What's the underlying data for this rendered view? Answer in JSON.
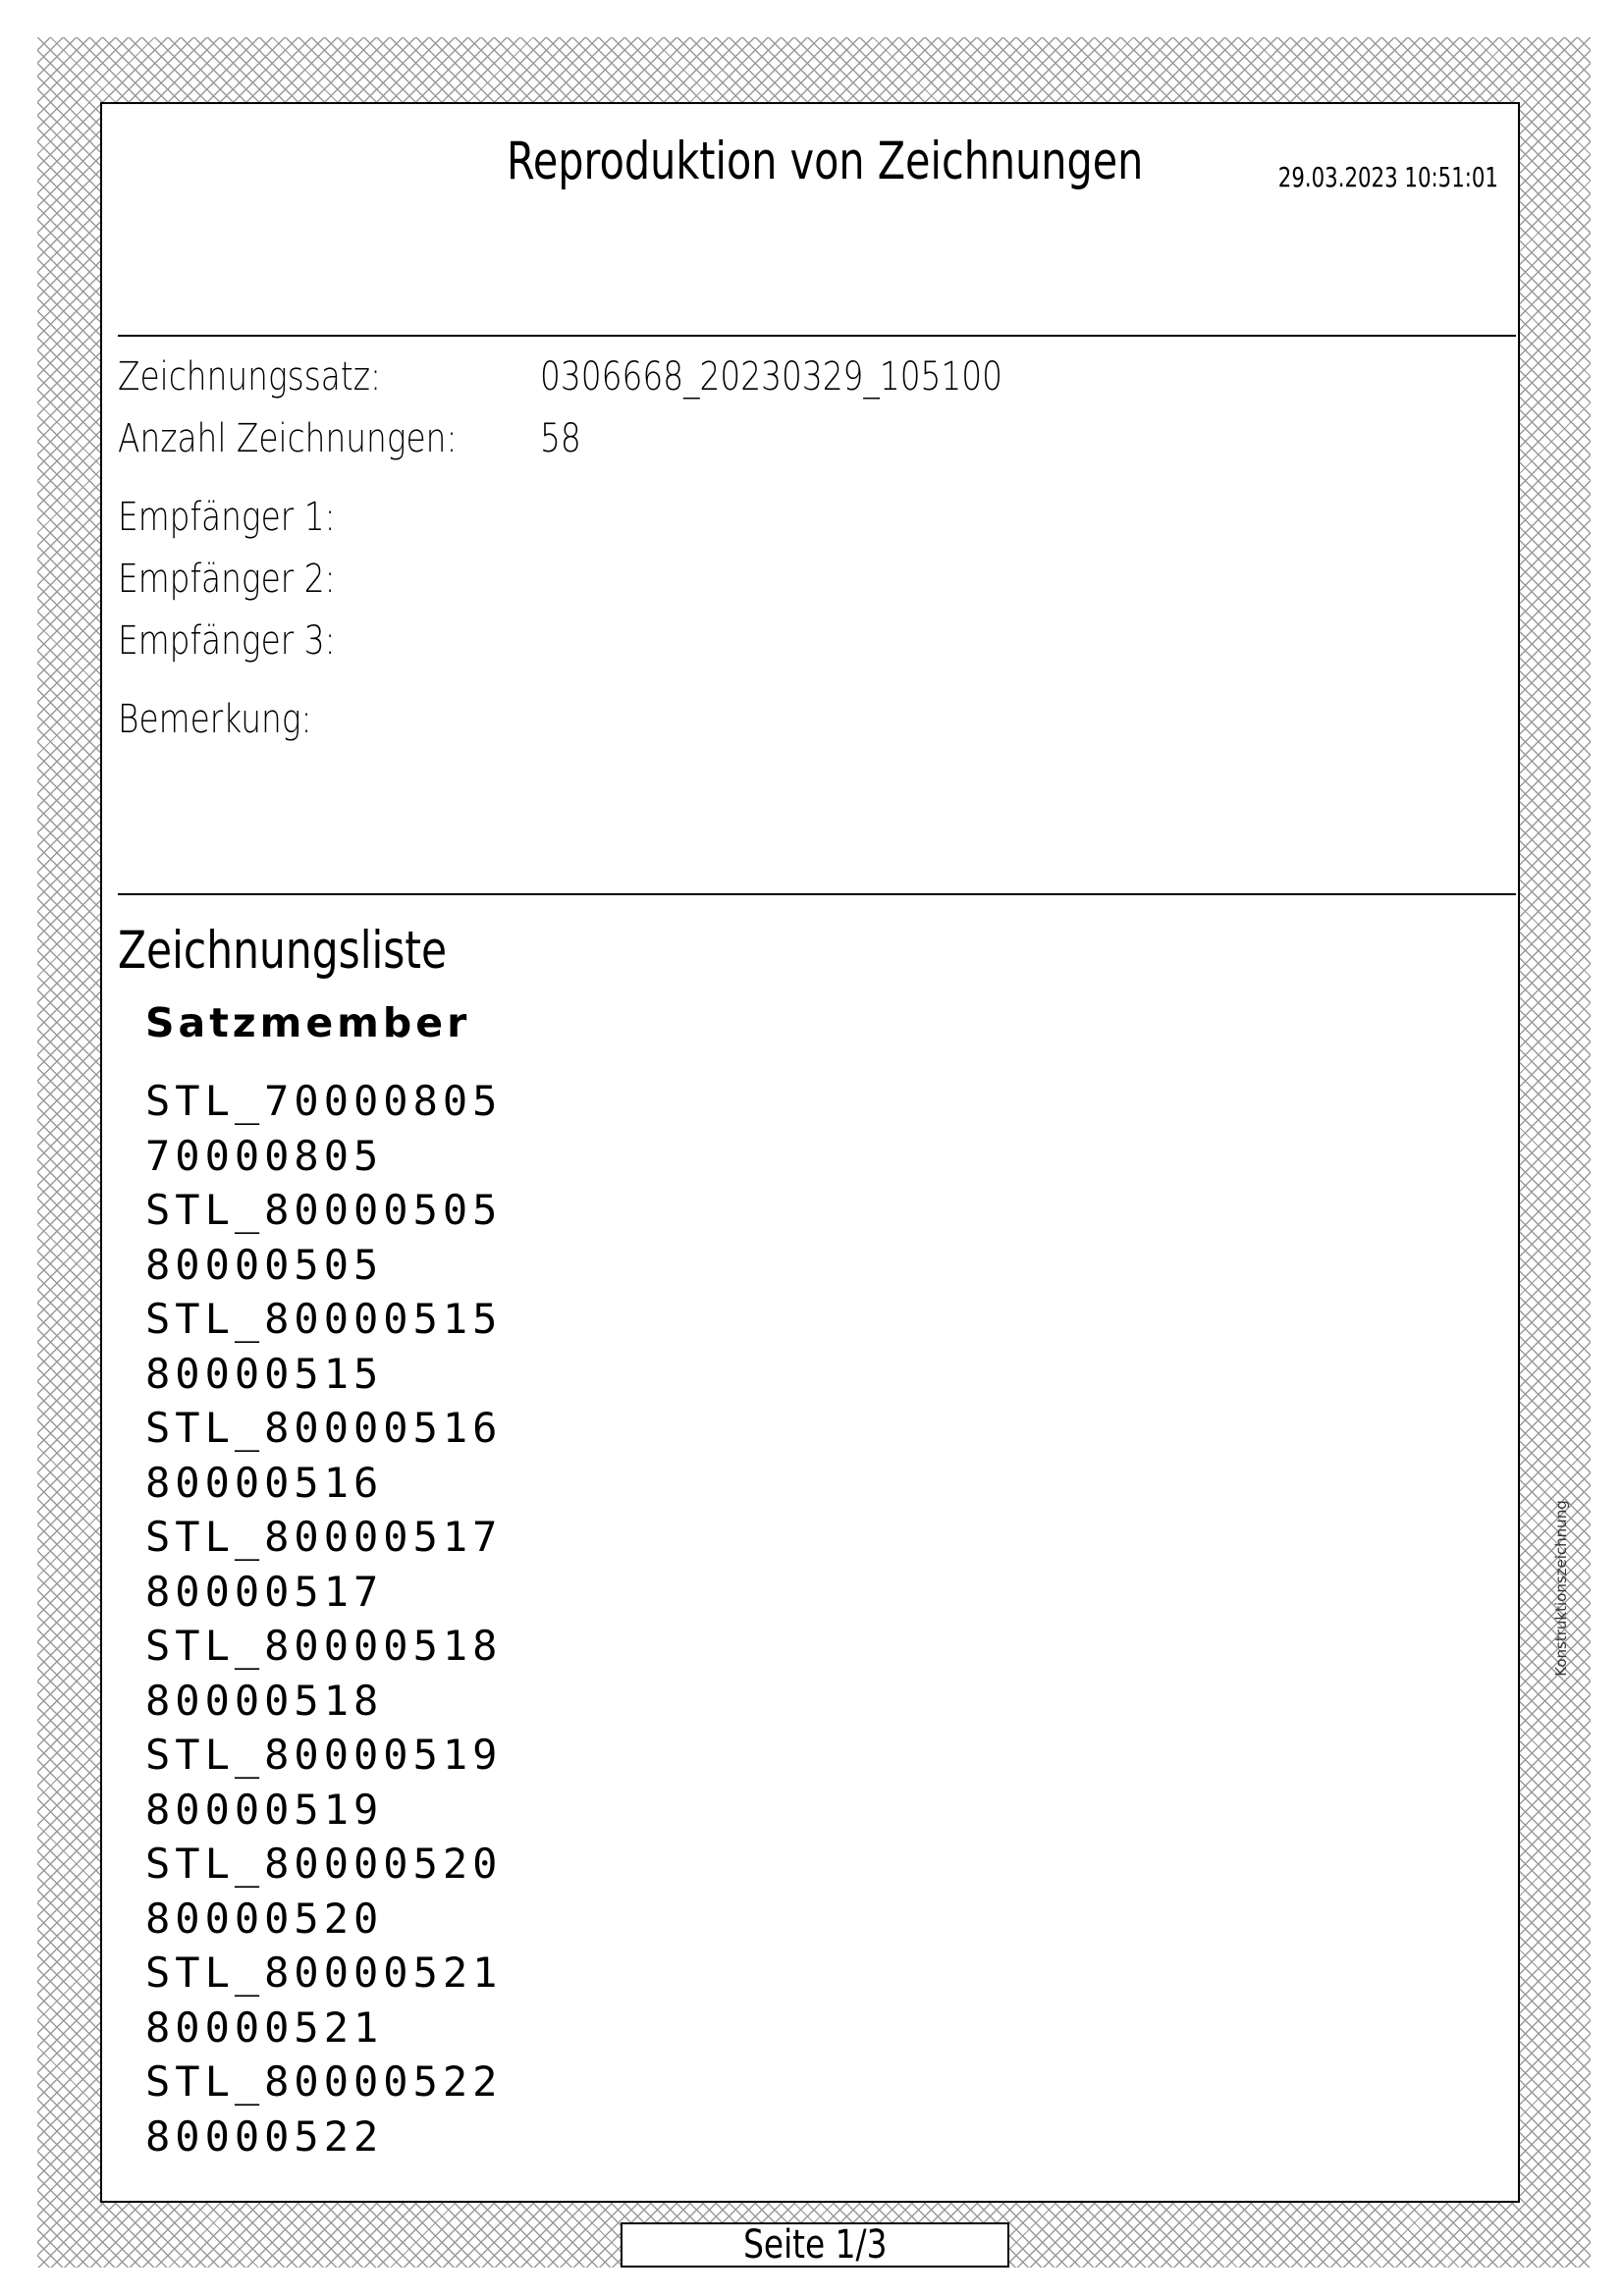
{
  "header": {
    "title": "Reproduktion von Zeichnungen",
    "timestamp": "29.03.2023 10:51:01"
  },
  "info": {
    "drawing_set_label": "Zeichnungssatz:",
    "drawing_set_value": "0306668_20230329_105100",
    "count_label": "Anzahl Zeichnungen:",
    "count_value": "58",
    "recipient1_label": "Empfänger 1:",
    "recipient2_label": "Empfänger 2:",
    "recipient3_label": "Empfänger 3:",
    "remark_label": "Bemerkung:"
  },
  "list": {
    "title": "Zeichnungsliste",
    "column_header": "Satzmember",
    "items": [
      "STL_70000805",
      "70000805",
      "STL_80000505",
      "80000505",
      "STL_80000515",
      "80000515",
      "STL_80000516",
      "80000516",
      "STL_80000517",
      "80000517",
      "STL_80000518",
      "80000518",
      "STL_80000519",
      "80000519",
      "STL_80000520",
      "80000520",
      "STL_80000521",
      "80000521",
      "STL_80000522",
      "80000522"
    ]
  },
  "side_label": "Konstruktionszeichnung",
  "footer": {
    "page": "Seite 1/3"
  }
}
